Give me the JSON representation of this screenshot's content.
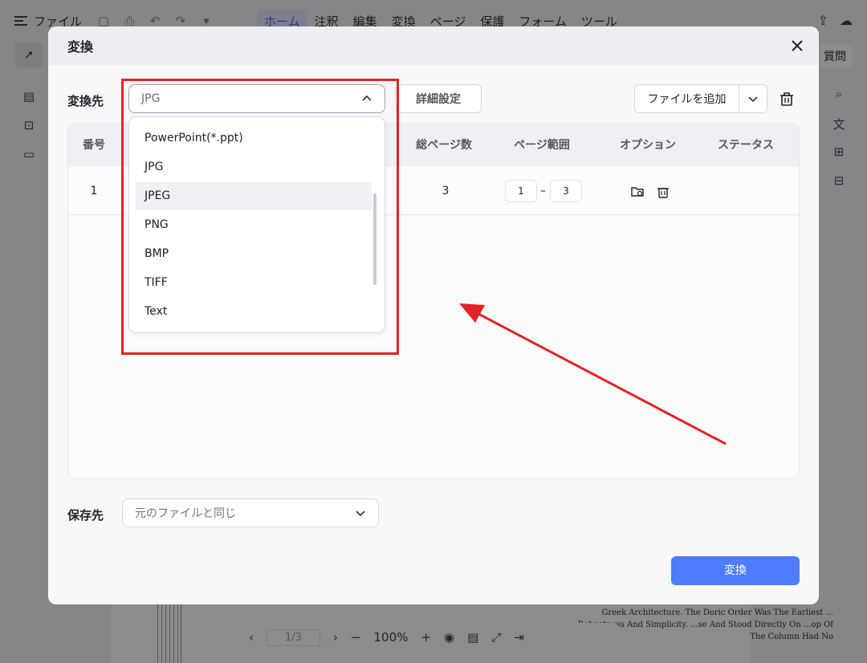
{
  "app": {
    "file_menu": "ファイル",
    "menu": [
      "ホーム",
      "注釈",
      "編集",
      "変換",
      "ページ",
      "保護",
      "フォーム",
      "ツール"
    ],
    "ask_label": "質問",
    "zoom": "100%",
    "page_indicator": "1/3",
    "doc_text": "Greek Architecture. The Doric Order Was The Earliest ... Robustness And Simplicity. ...se And Stood Directly On ...op Of The Column Had No"
  },
  "modal": {
    "title": "変換",
    "target_label": "変換先",
    "target_value": "JPG",
    "detail_button": "詳細設定",
    "add_file_button": "ファイルを追加",
    "save_label": "保存先",
    "save_value": "元のファイルと同じ",
    "convert_button": "変換"
  },
  "table": {
    "headers": [
      "番号",
      "総ページ数",
      "ページ範囲",
      "オプション",
      "ステータス"
    ],
    "rows": [
      {
        "no": "1",
        "total_pages": "3",
        "range_from": "1",
        "range_to": "3",
        "status": ""
      }
    ]
  },
  "dropdown": {
    "options": [
      "PowerPoint(*.ppt)",
      "JPG",
      "JPEG",
      "PNG",
      "BMP",
      "TIFF",
      "Text"
    ],
    "highlighted": "JPEG"
  },
  "colors": {
    "accent": "#4d7cff",
    "annotation_red": "#e02424"
  }
}
